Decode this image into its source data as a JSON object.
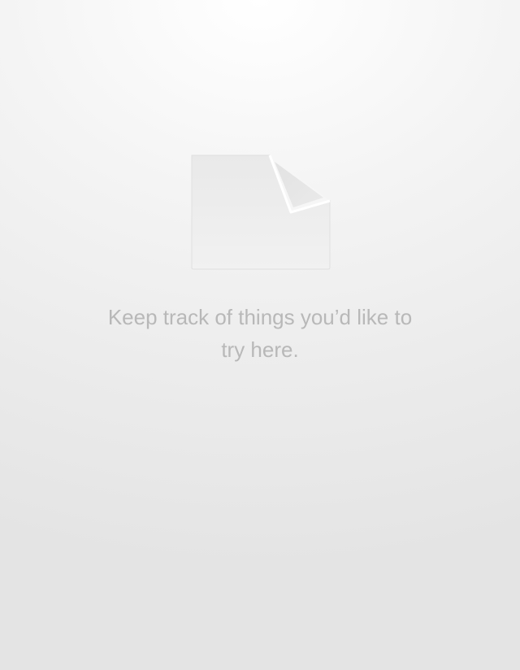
{
  "empty_state": {
    "icon": "blank-document-icon",
    "message": "Keep track of things you’d like to try here."
  }
}
